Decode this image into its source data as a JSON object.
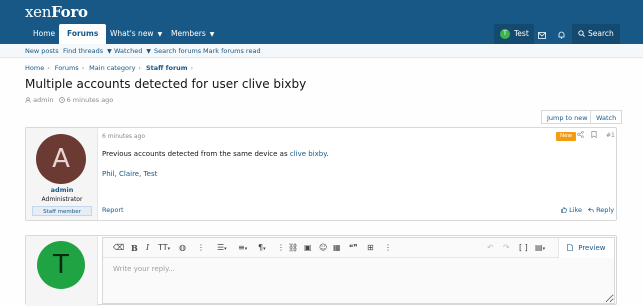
{
  "header": {
    "logo_main": "xen",
    "logo_bold": "Foro",
    "nav_tabs": [
      {
        "label": "Home"
      },
      {
        "label": "Forums"
      },
      {
        "label": "What's new"
      },
      {
        "label": "Members"
      }
    ],
    "user_initial": "T",
    "user_label": "Test",
    "search_label": "Search"
  },
  "subnav": {
    "items": [
      {
        "label": "New posts"
      },
      {
        "label": "Find threads"
      },
      {
        "label": "Watched"
      },
      {
        "label": "Search forums"
      },
      {
        "label": "Mark forums read"
      }
    ]
  },
  "breadcrumb": {
    "items": [
      {
        "label": "Home"
      },
      {
        "label": "Forums"
      },
      {
        "label": "Main category"
      },
      {
        "label": "Staff forum"
      }
    ]
  },
  "thread": {
    "title": "Multiple accounts detected for user clive bixby",
    "author": "admin",
    "time": "6 minutes ago",
    "jump_label": "Jump to new",
    "watch_label": "Watch"
  },
  "post": {
    "avatar_letter": "A",
    "username": "admin",
    "user_title": "Administrator",
    "user_banner": "Staff member",
    "time": "6 minutes ago",
    "badge": "New",
    "number": "#1",
    "body_text": "Previous accounts detected from the same device as ",
    "body_link": "clive bixby",
    "body_end": ".",
    "body_line2": "Phil, Claire, Test",
    "report_label": "Report",
    "like_label": "Like",
    "reply_label": "Reply"
  },
  "reply_box": {
    "avatar_letter": "T",
    "placeholder": "Write your reply...",
    "preview_label": "Preview"
  },
  "colors": {
    "header_bg": "#185886",
    "link": "#185886",
    "new_badge": "#f39c12",
    "avatar_admin": "#6b3a33",
    "avatar_test": "#1fa343"
  }
}
